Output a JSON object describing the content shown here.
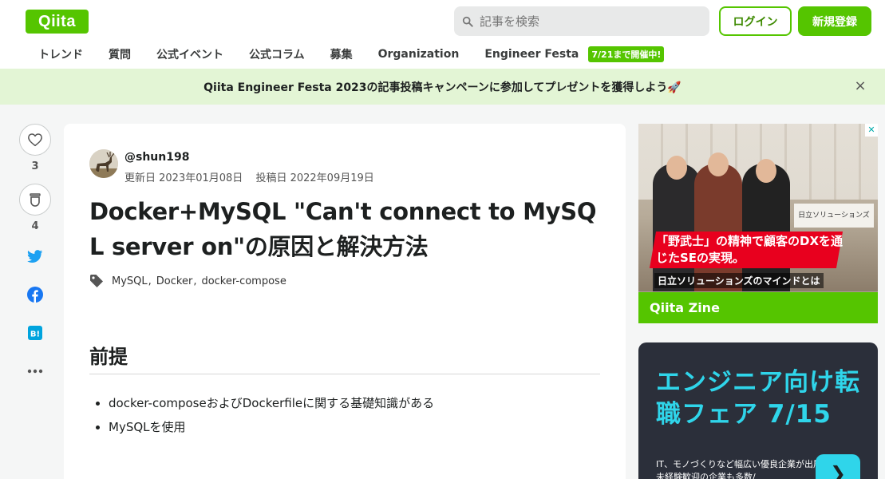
{
  "header": {
    "logo": "Qiita",
    "search_placeholder": "記事を検索",
    "login_label": "ログイン",
    "signup_label": "新規登録",
    "nav": [
      "トレンド",
      "質問",
      "公式イベント",
      "公式コラム",
      "募集",
      "Organization",
      "Engineer Festa"
    ],
    "nav_badge": "7/21まで開催中!"
  },
  "campaign": {
    "text": "Qiita Engineer Festa 2023の記事投稿キャンペーンに参加してプレゼントを獲得しよう🚀",
    "close": "×"
  },
  "actions": {
    "like_count": "3",
    "stock_count": "4"
  },
  "article": {
    "username": "@shun198",
    "updated": "更新日 2023年01月08日",
    "posted": "投稿日 2022年09月19日",
    "title": "Docker+MySQL \"Can't connect to MySQL server on\"の原因と解決方法",
    "tags": [
      "MySQL",
      "Docker",
      "docker-compose"
    ],
    "section_heading": "前提",
    "bullets": [
      "docker-composeおよびDockerfileに関する基礎知識がある",
      "MySQLを使用"
    ]
  },
  "ads": {
    "ad1_badge": "✕",
    "ad1_sign": "日立ソリューションズ",
    "ad1_headline": "「野武士」の精神で顧客のDXを通じたSEの実現。",
    "ad1_sub": "日立ソリューションズのマインドとは",
    "ad1_footer": "Qiita Zine",
    "ad2_title": "エンジニア向け転職フェア 7/15",
    "ad2_text": "IT、モノづくりなど幅広い優良企業が出展！未経験歓迎の企業も多数/",
    "ad2_button": "❯"
  },
  "colors": {
    "brand": "#55c500",
    "campaign_bg": "#e3f5d5",
    "twitter": "#1da1f2",
    "facebook": "#1877f2",
    "hatena": "#00a4de"
  }
}
